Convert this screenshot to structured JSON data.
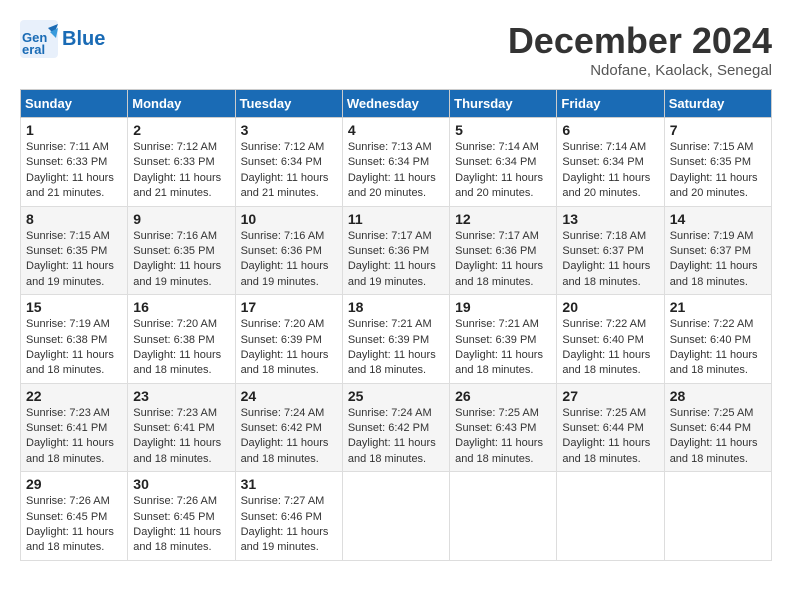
{
  "header": {
    "logo_line1": "General",
    "logo_line2": "Blue",
    "month_title": "December 2024",
    "location": "Ndofane, Kaolack, Senegal"
  },
  "weekdays": [
    "Sunday",
    "Monday",
    "Tuesday",
    "Wednesday",
    "Thursday",
    "Friday",
    "Saturday"
  ],
  "weeks": [
    [
      {
        "day": "1",
        "sunrise": "7:11 AM",
        "sunset": "6:33 PM",
        "daylight": "11 hours and 21 minutes."
      },
      {
        "day": "2",
        "sunrise": "7:12 AM",
        "sunset": "6:33 PM",
        "daylight": "11 hours and 21 minutes."
      },
      {
        "day": "3",
        "sunrise": "7:12 AM",
        "sunset": "6:34 PM",
        "daylight": "11 hours and 21 minutes."
      },
      {
        "day": "4",
        "sunrise": "7:13 AM",
        "sunset": "6:34 PM",
        "daylight": "11 hours and 20 minutes."
      },
      {
        "day": "5",
        "sunrise": "7:14 AM",
        "sunset": "6:34 PM",
        "daylight": "11 hours and 20 minutes."
      },
      {
        "day": "6",
        "sunrise": "7:14 AM",
        "sunset": "6:34 PM",
        "daylight": "11 hours and 20 minutes."
      },
      {
        "day": "7",
        "sunrise": "7:15 AM",
        "sunset": "6:35 PM",
        "daylight": "11 hours and 20 minutes."
      }
    ],
    [
      {
        "day": "8",
        "sunrise": "7:15 AM",
        "sunset": "6:35 PM",
        "daylight": "11 hours and 19 minutes."
      },
      {
        "day": "9",
        "sunrise": "7:16 AM",
        "sunset": "6:35 PM",
        "daylight": "11 hours and 19 minutes."
      },
      {
        "day": "10",
        "sunrise": "7:16 AM",
        "sunset": "6:36 PM",
        "daylight": "11 hours and 19 minutes."
      },
      {
        "day": "11",
        "sunrise": "7:17 AM",
        "sunset": "6:36 PM",
        "daylight": "11 hours and 19 minutes."
      },
      {
        "day": "12",
        "sunrise": "7:17 AM",
        "sunset": "6:36 PM",
        "daylight": "11 hours and 18 minutes."
      },
      {
        "day": "13",
        "sunrise": "7:18 AM",
        "sunset": "6:37 PM",
        "daylight": "11 hours and 18 minutes."
      },
      {
        "day": "14",
        "sunrise": "7:19 AM",
        "sunset": "6:37 PM",
        "daylight": "11 hours and 18 minutes."
      }
    ],
    [
      {
        "day": "15",
        "sunrise": "7:19 AM",
        "sunset": "6:38 PM",
        "daylight": "11 hours and 18 minutes."
      },
      {
        "day": "16",
        "sunrise": "7:20 AM",
        "sunset": "6:38 PM",
        "daylight": "11 hours and 18 minutes."
      },
      {
        "day": "17",
        "sunrise": "7:20 AM",
        "sunset": "6:39 PM",
        "daylight": "11 hours and 18 minutes."
      },
      {
        "day": "18",
        "sunrise": "7:21 AM",
        "sunset": "6:39 PM",
        "daylight": "11 hours and 18 minutes."
      },
      {
        "day": "19",
        "sunrise": "7:21 AM",
        "sunset": "6:39 PM",
        "daylight": "11 hours and 18 minutes."
      },
      {
        "day": "20",
        "sunrise": "7:22 AM",
        "sunset": "6:40 PM",
        "daylight": "11 hours and 18 minutes."
      },
      {
        "day": "21",
        "sunrise": "7:22 AM",
        "sunset": "6:40 PM",
        "daylight": "11 hours and 18 minutes."
      }
    ],
    [
      {
        "day": "22",
        "sunrise": "7:23 AM",
        "sunset": "6:41 PM",
        "daylight": "11 hours and 18 minutes."
      },
      {
        "day": "23",
        "sunrise": "7:23 AM",
        "sunset": "6:41 PM",
        "daylight": "11 hours and 18 minutes."
      },
      {
        "day": "24",
        "sunrise": "7:24 AM",
        "sunset": "6:42 PM",
        "daylight": "11 hours and 18 minutes."
      },
      {
        "day": "25",
        "sunrise": "7:24 AM",
        "sunset": "6:42 PM",
        "daylight": "11 hours and 18 minutes."
      },
      {
        "day": "26",
        "sunrise": "7:25 AM",
        "sunset": "6:43 PM",
        "daylight": "11 hours and 18 minutes."
      },
      {
        "day": "27",
        "sunrise": "7:25 AM",
        "sunset": "6:44 PM",
        "daylight": "11 hours and 18 minutes."
      },
      {
        "day": "28",
        "sunrise": "7:25 AM",
        "sunset": "6:44 PM",
        "daylight": "11 hours and 18 minutes."
      }
    ],
    [
      {
        "day": "29",
        "sunrise": "7:26 AM",
        "sunset": "6:45 PM",
        "daylight": "11 hours and 18 minutes."
      },
      {
        "day": "30",
        "sunrise": "7:26 AM",
        "sunset": "6:45 PM",
        "daylight": "11 hours and 18 minutes."
      },
      {
        "day": "31",
        "sunrise": "7:27 AM",
        "sunset": "6:46 PM",
        "daylight": "11 hours and 19 minutes."
      },
      null,
      null,
      null,
      null
    ]
  ]
}
